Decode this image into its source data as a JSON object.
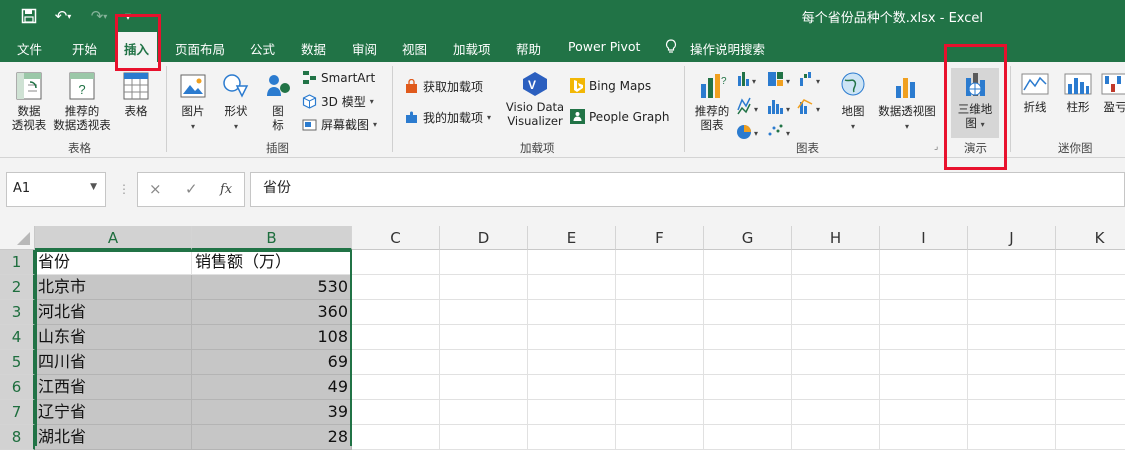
{
  "titlebar": {
    "title": "每个省份品种个数.xlsx  -  Excel",
    "undo_icon": "↶",
    "redo_icon": "↷",
    "save_icon": "save-icon"
  },
  "menubar": {
    "tabs": [
      "文件",
      "开始",
      "插入",
      "页面布局",
      "公式",
      "数据",
      "审阅",
      "视图",
      "加载项",
      "帮助",
      "Power Pivot",
      "操作说明搜索"
    ],
    "active_tab": "插入"
  },
  "ribbon": {
    "tables": {
      "pivot_line1": "数据",
      "pivot_line2": "透视表",
      "recommended_line1": "推荐的",
      "recommended_line2": "数据透视表",
      "table": "表格",
      "group": "表格"
    },
    "illustrations": {
      "picture": "图片",
      "shapes": "形状",
      "icons_line1": "图",
      "icons_line2": "标",
      "smartart": "SmartArt",
      "model3d": "3D 模型",
      "screenshot": "屏幕截图",
      "group": "插图"
    },
    "addins": {
      "get_addins": "获取加载项",
      "my_addins": "我的加载项",
      "visio_line1": "Visio Data",
      "visio_line2": "Visualizer",
      "bing_maps": "Bing Maps",
      "people_graph": "People Graph",
      "group": "加载项"
    },
    "charts": {
      "recommended_line1": "推荐的",
      "recommended_line2": "图表",
      "map": "地图",
      "pivot_chart": "数据透视图",
      "group": "图表"
    },
    "tours": {
      "map3d_line1": "三维地",
      "map3d_line2": "图",
      "group": "演示"
    },
    "sparklines": {
      "line": "折线",
      "column": "柱形",
      "winloss": "盈亏",
      "group": "迷你图"
    }
  },
  "formulabar": {
    "namebox": "A1",
    "cancel_icon": "×",
    "enter_icon": "✓",
    "fx_label": "fx",
    "content": "省份"
  },
  "sheet": {
    "columns": [
      "A",
      "B",
      "C",
      "D",
      "E",
      "F",
      "G",
      "H",
      "I",
      "J",
      "K"
    ],
    "rows": [
      {
        "num": "1",
        "a": "省份",
        "b": "销售额（万）"
      },
      {
        "num": "2",
        "a": "北京市",
        "b": "530"
      },
      {
        "num": "3",
        "a": "河北省",
        "b": "360"
      },
      {
        "num": "4",
        "a": "山东省",
        "b": "108"
      },
      {
        "num": "5",
        "a": "四川省",
        "b": "69"
      },
      {
        "num": "6",
        "a": "江西省",
        "b": "49"
      },
      {
        "num": "7",
        "a": "辽宁省",
        "b": "39"
      },
      {
        "num": "8",
        "a": "湖北省",
        "b": "28"
      }
    ]
  },
  "colors": {
    "excel_green": "#217346",
    "highlight_red": "#e8112d",
    "selection_gray": "#c6c6c6"
  }
}
